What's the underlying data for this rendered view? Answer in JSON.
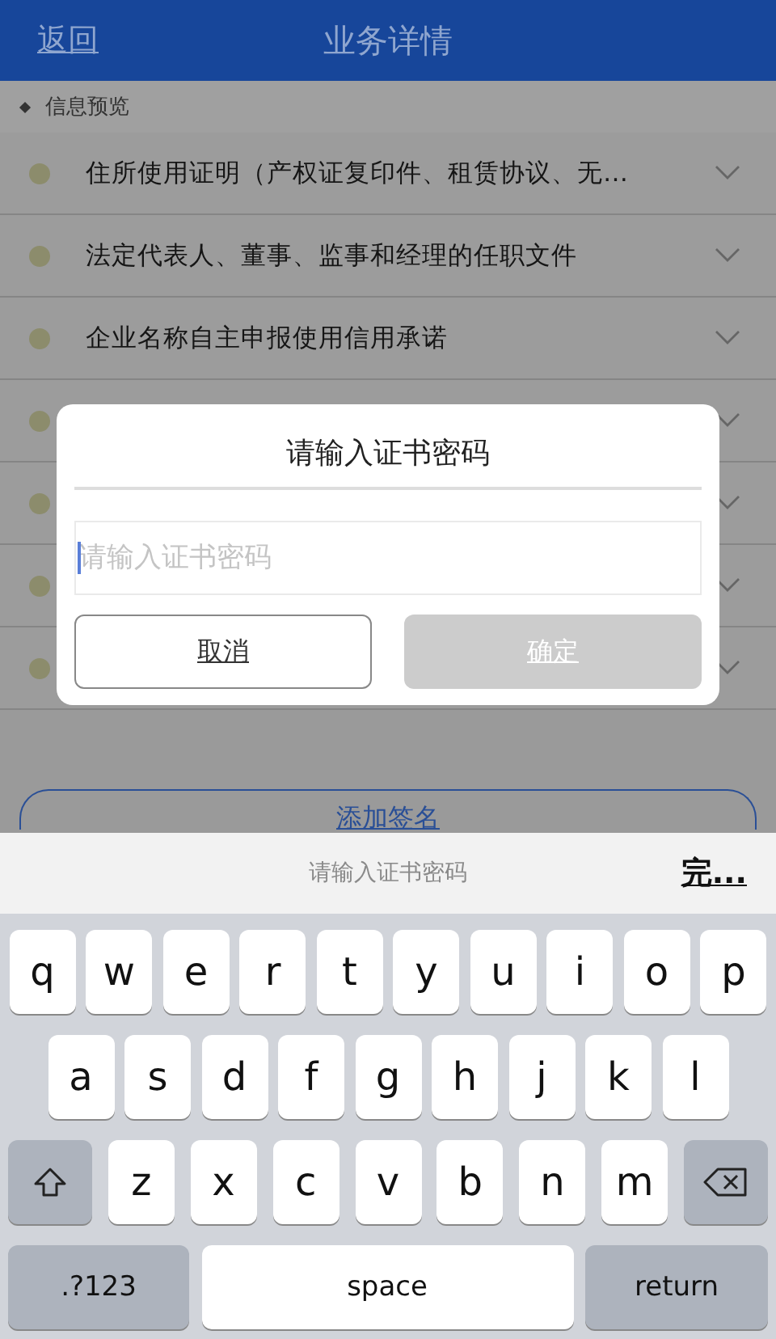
{
  "nav_bar": {
    "back": "返回",
    "title": "业务详情"
  },
  "section": {
    "label": "信息预览"
  },
  "items": [
    {
      "title": "住所使用证明（产权证复印件、租赁协议、无…",
      "expanded": false
    },
    {
      "title": "法定代表人、董事、监事和经理的任职文件",
      "expanded": false
    },
    {
      "title": "企业名称自主申报使用信用承诺",
      "expanded": false
    },
    {
      "expanded": false
    },
    {
      "expanded": false
    },
    {
      "expanded": false
    },
    {
      "expanded": false
    }
  ],
  "add_signature_button": "添加签名",
  "dialog": {
    "title": "请输入证书密码",
    "input": {
      "placeholder": "请输入证书密码"
    },
    "buttons": [
      {
        "label": "取消",
        "kind": "cancel",
        "disabled": false
      },
      {
        "label": "确定",
        "kind": "confirm",
        "disabled": true
      }
    ]
  },
  "keyboard": {
    "toolbar_hint": "请输入证书密码",
    "done": "完...",
    "key_rows": [
      {
        "keys": [
          {
            "kind": "letter",
            "label": "q"
          },
          {
            "kind": "letter",
            "label": "w"
          },
          {
            "kind": "letter",
            "label": "e"
          },
          {
            "kind": "letter",
            "label": "r"
          },
          {
            "kind": "letter",
            "label": "t"
          },
          {
            "kind": "letter",
            "label": "y"
          },
          {
            "kind": "letter",
            "label": "u"
          },
          {
            "kind": "letter",
            "label": "i"
          },
          {
            "kind": "letter",
            "label": "o"
          },
          {
            "kind": "letter",
            "label": "p"
          }
        ]
      },
      {
        "keys": [
          {
            "kind": "letter",
            "label": "a"
          },
          {
            "kind": "letter",
            "label": "s"
          },
          {
            "kind": "letter",
            "label": "d"
          },
          {
            "kind": "letter",
            "label": "f"
          },
          {
            "kind": "letter",
            "label": "g"
          },
          {
            "kind": "letter",
            "label": "h"
          },
          {
            "kind": "letter",
            "label": "j"
          },
          {
            "kind": "letter",
            "label": "k"
          },
          {
            "kind": "letter",
            "label": "l"
          }
        ]
      },
      {
        "keys": [
          {
            "kind": "shift"
          },
          {
            "kind": "letter",
            "label": "z"
          },
          {
            "kind": "letter",
            "label": "x"
          },
          {
            "kind": "letter",
            "label": "c"
          },
          {
            "kind": "letter",
            "label": "v"
          },
          {
            "kind": "letter",
            "label": "b"
          },
          {
            "kind": "letter",
            "label": "n"
          },
          {
            "kind": "letter",
            "label": "m"
          },
          {
            "kind": "delete"
          }
        ]
      },
      {
        "keys": [
          {
            "kind": "mode",
            "label": ".?123"
          },
          {
            "kind": "space",
            "label": "space"
          },
          {
            "kind": "return",
            "label": "return"
          }
        ]
      }
    ]
  }
}
